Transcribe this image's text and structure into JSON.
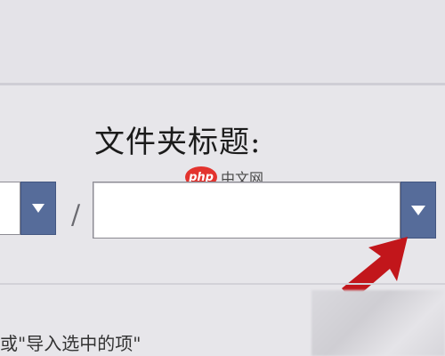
{
  "form": {
    "folder_title_label": "文件夹标题:",
    "separator": "/",
    "left_select": {
      "value": ""
    },
    "folder_select": {
      "value": ""
    }
  },
  "watermark": {
    "logo_text": "php",
    "site_text": "中文网"
  },
  "footer": {
    "partial_text": "或\"导入选中的项\""
  },
  "colors": {
    "background": "#e7e6ea",
    "dropdown_button": "#566c9a",
    "arrow_annotation": "#c2161b",
    "watermark_red": "#e3332e"
  },
  "icons": {
    "dropdown": "chevron-down-icon",
    "annotation": "red-arrow-icon"
  }
}
